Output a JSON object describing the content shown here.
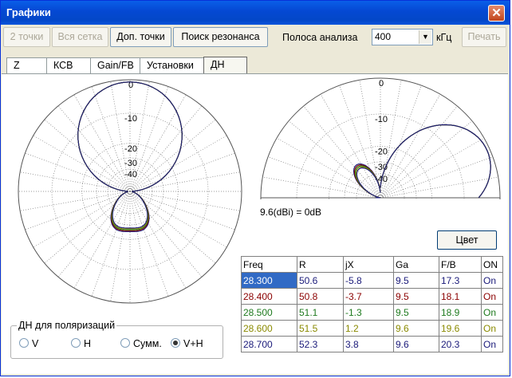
{
  "window": {
    "title": "Графики",
    "close": "✕"
  },
  "toolbar": {
    "btn_2points": "2 точки",
    "btn_allgrid": "Вся сетка",
    "btn_extra": "Доп. точки",
    "btn_resonance": "Поиск резонанса",
    "band_label": "Полоса анализа",
    "band_value": "400",
    "band_unit": "кГц",
    "btn_print": "Печать"
  },
  "tabs": [
    "Z",
    "КСВ",
    "Gain/FB",
    "Установки",
    "ДН"
  ],
  "chart_data": [
    {
      "type": "polar",
      "name": "azimuth",
      "rings": [
        0,
        -10,
        -20,
        -30,
        -40
      ],
      "ring_labels": [
        "0",
        "-10",
        "-20",
        "-30",
        "-40"
      ],
      "main_lobe_db": 0,
      "back_lobe_db": -18.5
    },
    {
      "type": "polar-half",
      "name": "elevation",
      "rings": [
        0,
        -10,
        -20,
        -30,
        -40
      ],
      "ring_labels": [
        "0",
        "-10",
        "-20",
        "-30",
        "-40"
      ],
      "peak_elevation_deg": 24
    }
  ],
  "reference_text": "9.6(dBi) = 0dB",
  "color_button": "Цвет",
  "table": {
    "headers": [
      "Freq",
      "R",
      "jX",
      "Ga",
      "F/B",
      "ON"
    ],
    "rows": [
      {
        "freq": "28.300",
        "r": "50.6",
        "jx": "-5.8",
        "ga": "9.5",
        "fb": "17.3",
        "on": "On",
        "color": "#1a1a7a"
      },
      {
        "freq": "28.400",
        "r": "50.8",
        "jx": "-3.7",
        "ga": "9.5",
        "fb": "18.1",
        "on": "On",
        "color": "#8b0000"
      },
      {
        "freq": "28.500",
        "r": "51.1",
        "jx": "-1.3",
        "ga": "9.5",
        "fb": "18.9",
        "on": "On",
        "color": "#1e7a1e"
      },
      {
        "freq": "28.600",
        "r": "51.5",
        "jx": "1.2",
        "ga": "9.6",
        "fb": "19.6",
        "on": "On",
        "color": "#8a8a00"
      },
      {
        "freq": "28.700",
        "r": "52.3",
        "jx": "3.8",
        "ga": "9.6",
        "fb": "20.3",
        "on": "On",
        "color": "#1a1a7a"
      }
    ]
  },
  "polarization": {
    "caption": "ДН для поляризаций",
    "options": [
      "V",
      "H",
      "Сумм.",
      "V+H"
    ],
    "selected": "V+H"
  },
  "colors": {
    "titlebar": "#0549d4",
    "selection": "#316ac5"
  }
}
